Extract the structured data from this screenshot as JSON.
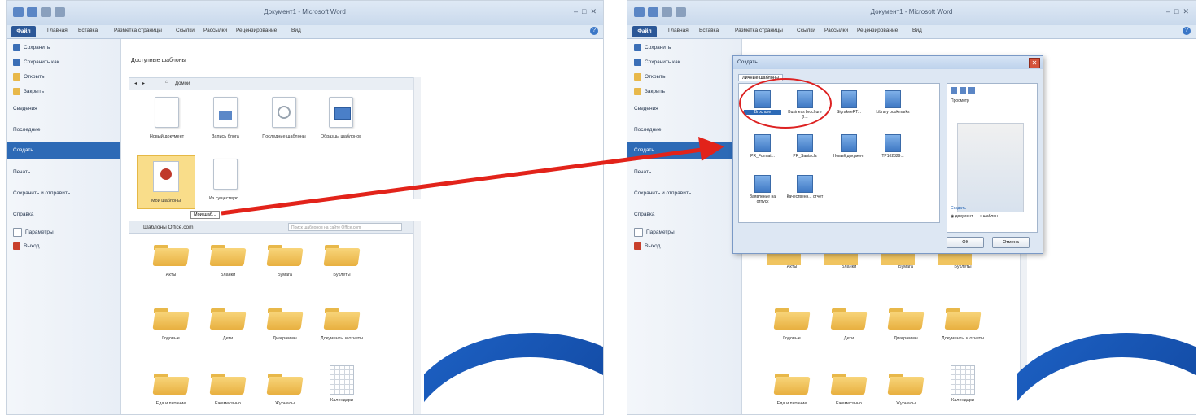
{
  "left": {
    "title": "Документ1 - Microsoft Word",
    "tabs": [
      "Файл",
      "Главная",
      "Вставка",
      "Разметка страницы",
      "Ссылки",
      "Рассылки",
      "Рецензирование",
      "Вид"
    ],
    "nav": [
      "Сохранить",
      "Сохранить как",
      "Открыть",
      "Закрыть",
      "Сведения",
      "Последние",
      "Создать",
      "Печать",
      "Сохранить и отправить",
      "Справка",
      "Параметры",
      "Выход"
    ],
    "section_title": "Доступные шаблоны",
    "path": "Домой",
    "templates": [
      "Новый документ",
      "Запись блога",
      "Последние шаблоны",
      "Образцы шаблонов",
      "Мои шаблоны",
      "Из существую..."
    ],
    "tooltip": "Мои шаб...",
    "office_bar": "Шаблоны Office.com",
    "search_placeholder": "Поиск шаблонов на сайте Office.com",
    "folders": [
      "Акты",
      "Бланки",
      "Бумага",
      "Буклеты",
      "Годовые",
      "Дети",
      "Диаграммы",
      "Документы и отчеты",
      "Еда и питание",
      "Ежемесячно",
      "Журналы",
      "Календари"
    ]
  },
  "right": {
    "title": "Документ1 - Microsoft Word",
    "tabs": [
      "Файл",
      "Главная",
      "Вставка",
      "Разметка страницы",
      "Ссылки",
      "Рассылки",
      "Рецензирование",
      "Вид"
    ],
    "nav": [
      "Сохранить",
      "Сохранить как",
      "Открыть",
      "Закрыть",
      "Сведения",
      "Последние",
      "Создать",
      "Печать",
      "Сохранить и отправить",
      "Справка",
      "Параметры",
      "Выход"
    ],
    "folders": [
      "Акты",
      "Бланки",
      "Бумага",
      "Буклеты",
      "Годовые",
      "Дети",
      "Диаграммы",
      "Документы и отчеты",
      "Еда и питание",
      "Ежемесячно",
      "Журналы",
      "Календари"
    ]
  },
  "dialog": {
    "title": "Создать",
    "tab": "Личные шаблоны",
    "items": [
      "Brochure",
      "Business brochure (I...",
      "SigrakeeRT...",
      "Library bookmarks",
      "PR_Format...",
      "PR_Santacla",
      "Новый документ",
      "TP102329...",
      "Заявление на отпуск",
      "Качественн... отчет"
    ],
    "preview_label": "Просмотр",
    "create_label": "Создать",
    "radio_doc": "документ",
    "radio_tpl": "шаблон",
    "ok": "ОК",
    "cancel": "Отмена"
  },
  "colors": {
    "accent": "#2d6ab6",
    "arrow": "#e2231a",
    "circle": "#dd2222"
  }
}
